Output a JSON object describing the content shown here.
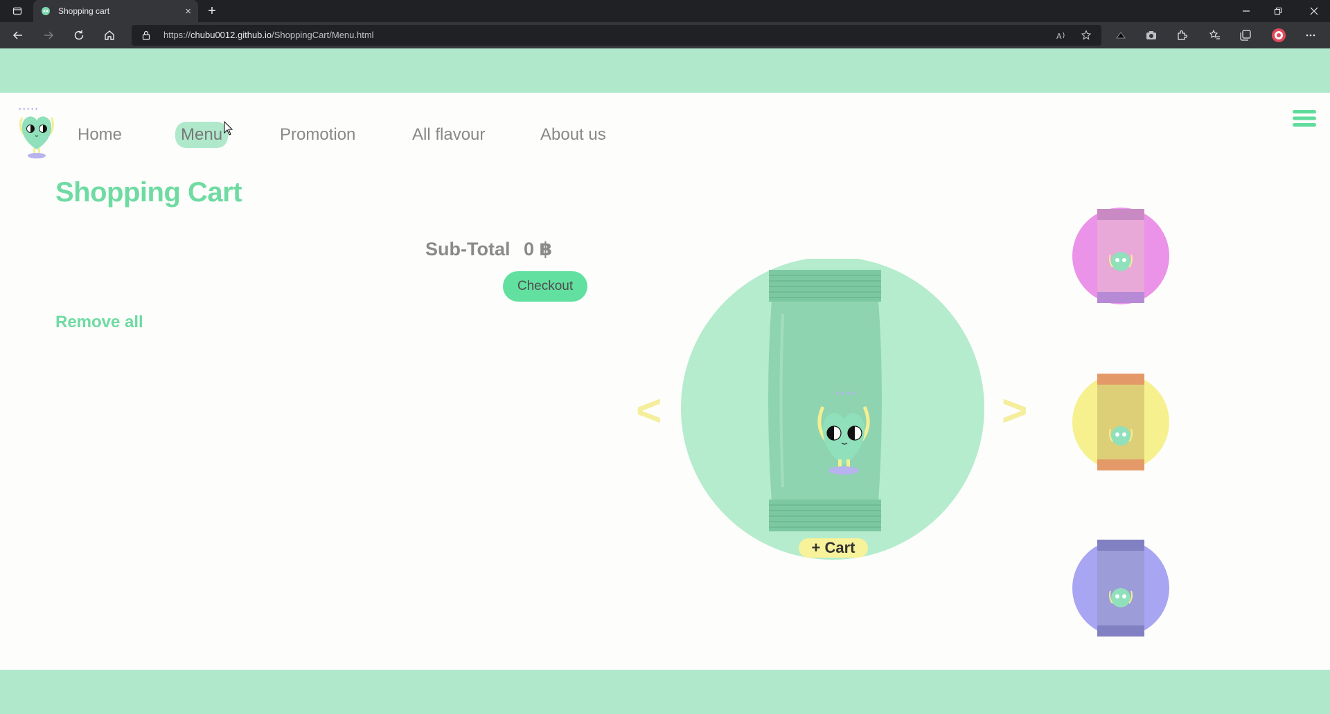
{
  "browser": {
    "tab_title": "Shopping cart",
    "url_prefix": "https://",
    "url_host": "chubu0012.github.io",
    "url_path": "/ShoppingCart/Menu.html",
    "new_tab_glyph": "+",
    "close_glyph": "×"
  },
  "nav": {
    "items": [
      {
        "label": "Home"
      },
      {
        "label": "Menu",
        "active": true
      },
      {
        "label": "Promotion"
      },
      {
        "label": "All flavour"
      },
      {
        "label": "About us"
      }
    ]
  },
  "cart": {
    "title": "Shopping Cart",
    "subtotal_label": "Sub-Total",
    "subtotal_value": "0 ฿",
    "checkout_label": "Checkout",
    "remove_all_label": "Remove all"
  },
  "carousel": {
    "prev_label": "<",
    "next_label": ">",
    "add_to_cart_label": "+ Cart",
    "featured_color": "#b4eccd",
    "thumbnails": [
      {
        "circle_color": "#ea93e8",
        "pack_color": "#e8a8d8"
      },
      {
        "circle_color": "#f6f08e",
        "pack_color": "#dccf78"
      },
      {
        "circle_color": "#a8a5f2",
        "pack_color": "#9c9cd8"
      }
    ]
  },
  "colors": {
    "band": "#b0e8cc",
    "accent_green": "#6fdba2",
    "checkout_bg": "#62e0a0",
    "arrow_yellow": "#f4ee9d"
  }
}
